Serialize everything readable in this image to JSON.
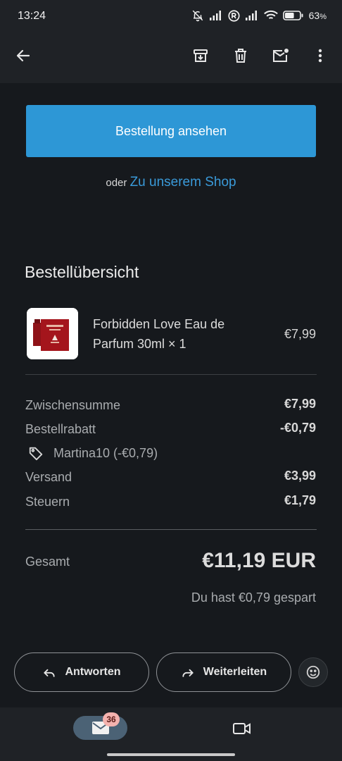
{
  "status_bar": {
    "time": "13:24",
    "battery_percent": "63",
    "battery_suffix": "%",
    "battery_level": 0.63,
    "icons": [
      "bell-off-icon",
      "signal-icon",
      "roaming-r-icon",
      "signal-icon",
      "wifi-icon",
      "battery-icon"
    ]
  },
  "app_bar": {
    "icons": [
      "back-arrow-icon",
      "archive-icon",
      "delete-icon",
      "mark-unread-icon",
      "more-vert-icon"
    ]
  },
  "email": {
    "view_order_button": "Bestellung ansehen",
    "shop_prefix": "oder",
    "shop_link": "Zu unserem Shop",
    "summary_title": "Bestellübersicht",
    "product": {
      "name": "Forbidden Love Eau de Parfum 30ml × 1",
      "price": "€7,99",
      "thumbnail_colors": [
        "#ffffff",
        "#a4151c"
      ]
    },
    "rows": [
      {
        "label": "Zwischensumme",
        "value": "€7,99"
      },
      {
        "label": "Bestellrabatt",
        "value": "-€0,79"
      },
      {
        "label": "Versand",
        "value": "€3,99"
      },
      {
        "label": "Steuern",
        "value": "€1,79"
      }
    ],
    "discount_code": "Martina10 (-€0,79)",
    "total_label": "Gesamt",
    "total_value": "€11,19 EUR",
    "saved_text": "Du hast €0,79 gespart"
  },
  "actions": {
    "reply": "Antworten",
    "forward": "Weiterleiten",
    "emoji_icon": "emoji-icon"
  },
  "bottom_nav": {
    "mail_badge": "36",
    "tabs": [
      "mail-icon",
      "video-icon"
    ]
  },
  "colors": {
    "accent": "#2d97d6",
    "link": "#3a9ad9",
    "background": "#16191d",
    "badge": "#f4b2ae"
  }
}
